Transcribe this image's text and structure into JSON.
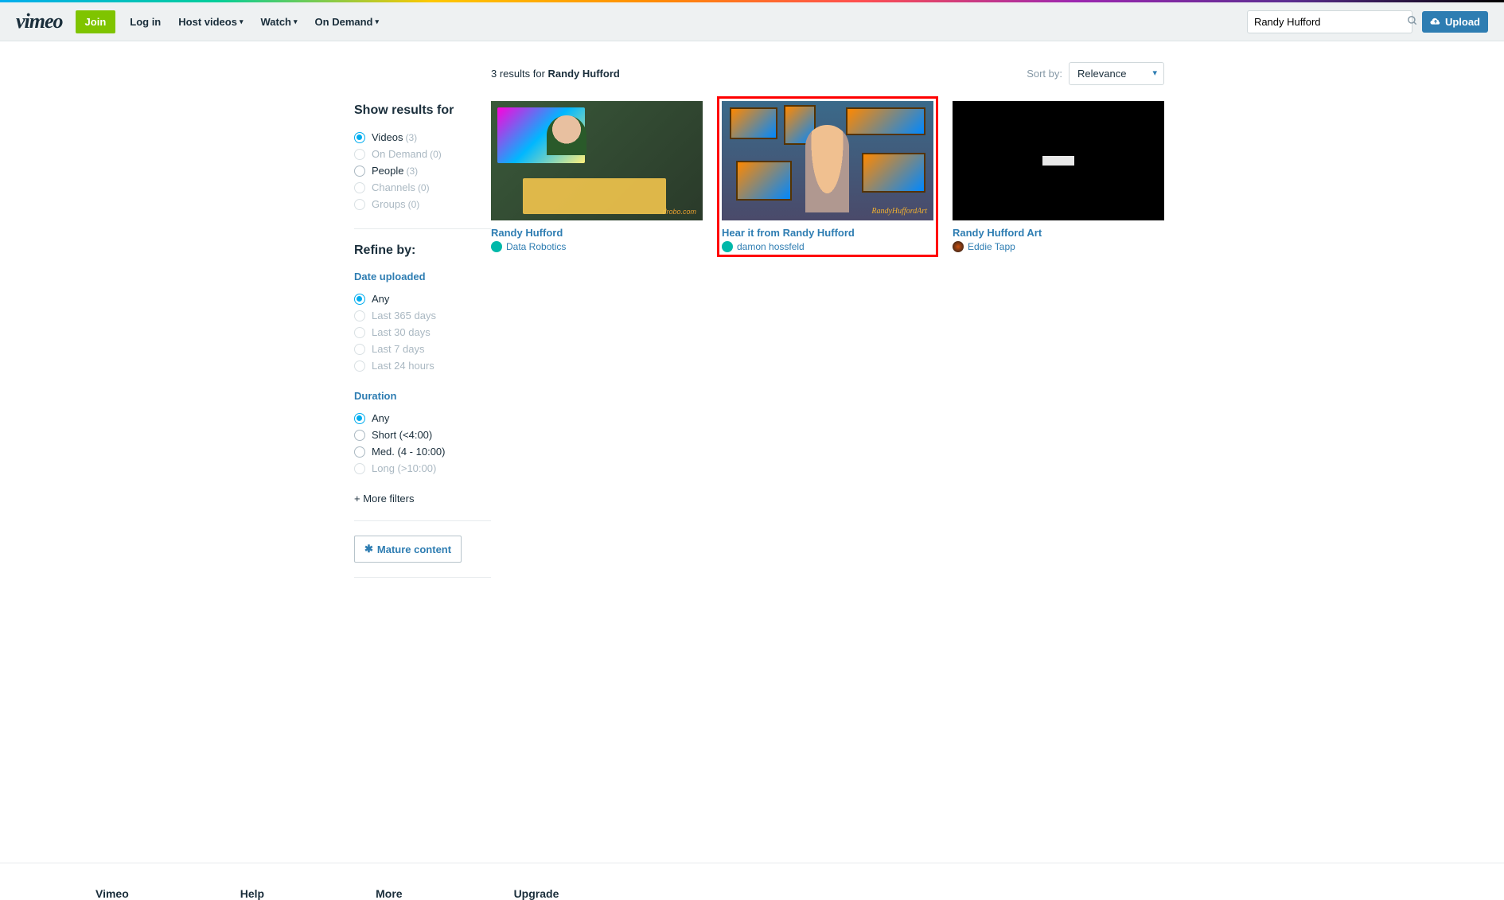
{
  "header": {
    "join": "Join",
    "login": "Log in",
    "nav": [
      "Host videos",
      "Watch",
      "On Demand"
    ],
    "search_value": "Randy Hufford",
    "upload": "Upload"
  },
  "results": {
    "count": "3 results for",
    "query": "Randy Hufford",
    "sort_label": "Sort by:",
    "sort_value": "Relevance"
  },
  "sidebar": {
    "show_results_title": "Show results for",
    "show_results": [
      {
        "label": "Videos",
        "count": "(3)",
        "selected": true,
        "disabled": false
      },
      {
        "label": "On Demand",
        "count": "(0)",
        "selected": false,
        "disabled": true
      },
      {
        "label": "People",
        "count": "(3)",
        "selected": false,
        "disabled": false
      },
      {
        "label": "Channels",
        "count": "(0)",
        "selected": false,
        "disabled": true
      },
      {
        "label": "Groups",
        "count": "(0)",
        "selected": false,
        "disabled": true
      }
    ],
    "refine_title": "Refine by:",
    "date_title": "Date uploaded",
    "date": [
      {
        "label": "Any",
        "selected": true,
        "disabled": false
      },
      {
        "label": "Last 365 days",
        "selected": false,
        "disabled": true
      },
      {
        "label": "Last 30 days",
        "selected": false,
        "disabled": true
      },
      {
        "label": "Last 7 days",
        "selected": false,
        "disabled": true
      },
      {
        "label": "Last 24 hours",
        "selected": false,
        "disabled": true
      }
    ],
    "duration_title": "Duration",
    "duration": [
      {
        "label": "Any",
        "selected": true,
        "disabled": false
      },
      {
        "label": "Short (<4:00)",
        "selected": false,
        "disabled": false
      },
      {
        "label": "Med. (4 - 10:00)",
        "selected": false,
        "disabled": false
      },
      {
        "label": "Long (>10:00)",
        "selected": false,
        "disabled": true
      }
    ],
    "more_filters": "+ More filters",
    "mature": "Mature content"
  },
  "cards": [
    {
      "title": "Randy Hufford",
      "user": "Data Robotics",
      "highlighted": false
    },
    {
      "title": "Hear it from Randy Hufford",
      "user": "damon hossfeld",
      "highlighted": true
    },
    {
      "title": "Randy Hufford Art",
      "user": "Eddie Tapp",
      "highlighted": false
    }
  ],
  "footer": {
    "cols": [
      "Vimeo",
      "Help",
      "More",
      "Upgrade"
    ]
  }
}
